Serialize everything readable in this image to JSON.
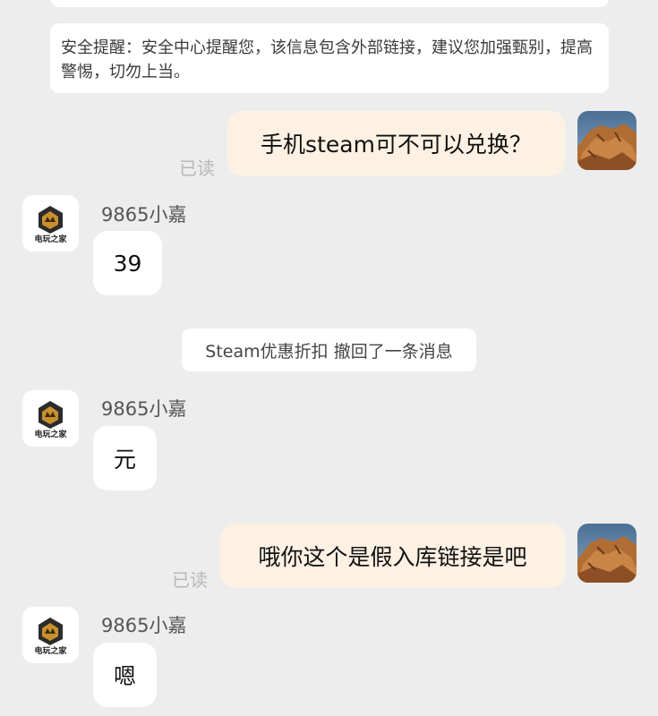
{
  "security_notice": {
    "text": "安全提醒：安全中心提醒您，该信息包含外部链接，建议您加强甄别，提高警惕，切勿上当。"
  },
  "messages": [
    {
      "from": "self",
      "text": "手机steam可不可以兑换？",
      "status": "已读"
    },
    {
      "from": "contact",
      "sender": "9865小嘉",
      "text": "39"
    },
    {
      "from": "contact",
      "sender": "9865小嘉",
      "text": "元"
    },
    {
      "from": "self",
      "text": "哦你这个是假入库链接是吧",
      "status": "已读"
    },
    {
      "from": "contact",
      "sender": "9865小嘉",
      "text": "嗯"
    }
  ],
  "system_message": {
    "text": "Steam优惠折扣 撤回了一条消息"
  },
  "contact_avatar": {
    "logo_text": "电玩之家"
  },
  "colors": {
    "background": "#ededed",
    "outgoing_bubble": "#fdf1e3",
    "incoming_bubble": "#ffffff",
    "read_status": "#b8b8b8"
  }
}
